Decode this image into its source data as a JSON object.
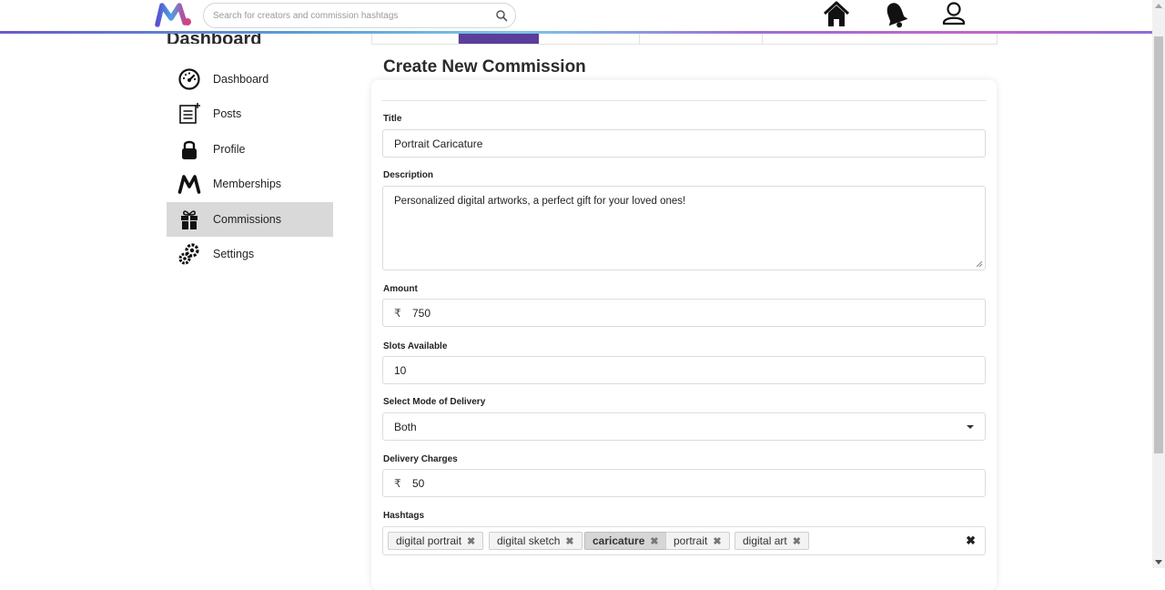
{
  "header": {
    "search_placeholder": "Search for creators and commission hashtags",
    "icons": [
      "logo-icon",
      "search-icon",
      "home-icon",
      "bell-icon",
      "user-icon"
    ]
  },
  "sidebar": {
    "title": "Dashboard",
    "items": [
      {
        "label": "Dashboard",
        "icon": "speedometer-icon"
      },
      {
        "label": "Posts",
        "icon": "posts-icon"
      },
      {
        "label": "Profile",
        "icon": "lock-icon"
      },
      {
        "label": "Memberships",
        "icon": "m-logo-icon"
      },
      {
        "label": "Commissions",
        "icon": "gift-icon",
        "active": true
      },
      {
        "label": "Settings",
        "icon": "gears-icon"
      }
    ]
  },
  "form": {
    "heading": "Create New Commission",
    "title_label": "Title",
    "title_value": "Portrait Caricature",
    "description_label": "Description",
    "description_value": "Personalized digital artworks, a perfect gift for your loved ones!",
    "amount_label": "Amount",
    "currency_symbol": "₹",
    "amount_value": "750",
    "slots_label": "Slots Available",
    "slots_value": "10",
    "delivery_mode_label": "Select Mode of Delivery",
    "delivery_mode_value": "Both",
    "delivery_charges_label": "Delivery Charges",
    "delivery_charges_value": "50",
    "hashtags_label": "Hashtags",
    "hashtags": [
      "digital portrait",
      "digital sketch",
      "caricature",
      "portrait",
      "digital art"
    ],
    "selected_hashtag": "caricature",
    "remove_glyph": "✖"
  },
  "colors": {
    "active_tab": "#5a3e9b",
    "active_sidebar": "#d9d9d9",
    "accent_gradient": [
      "#6a5acd",
      "#7cc7e8",
      "#c264c9"
    ]
  }
}
